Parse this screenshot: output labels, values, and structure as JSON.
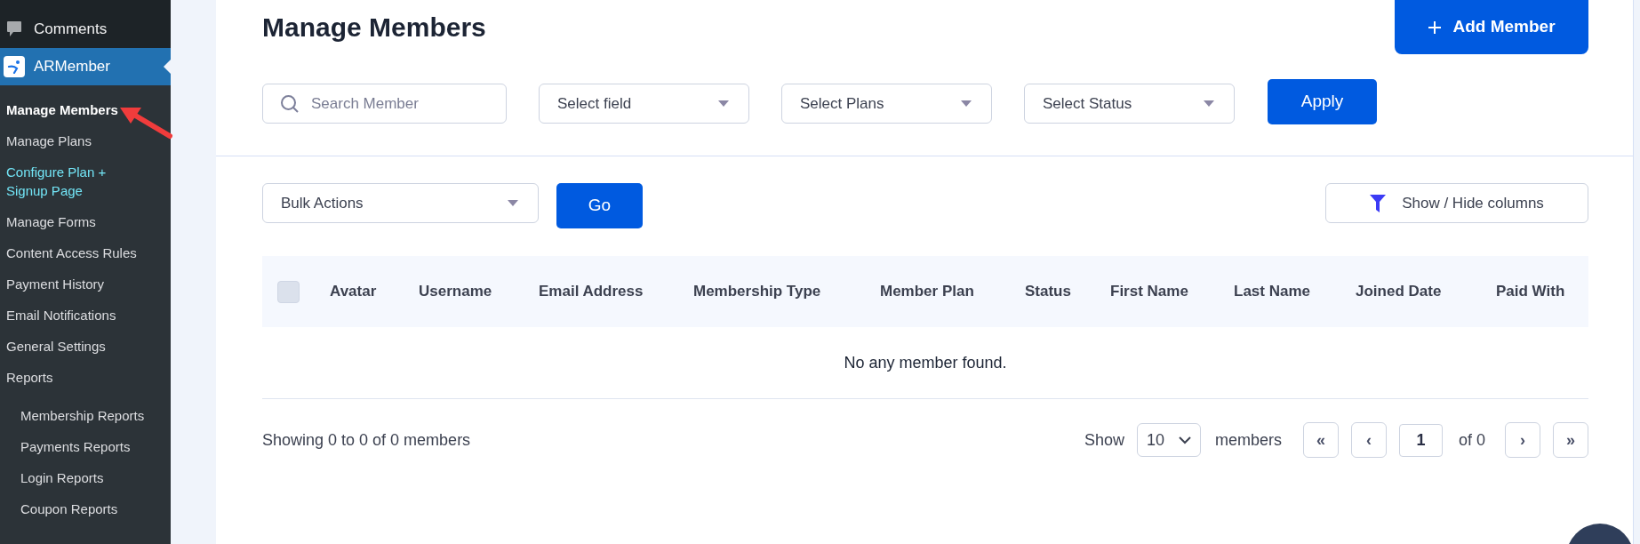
{
  "sidebar": {
    "items": [
      {
        "label": "Comments",
        "kind": "comments",
        "selected": false
      },
      {
        "label": "ARMember",
        "kind": "plugin",
        "selected": true
      }
    ],
    "submenu": [
      {
        "label": "Manage Members",
        "selected": true,
        "hovered": false
      },
      {
        "label": "Manage Plans",
        "selected": false,
        "hovered": false
      },
      {
        "label": "Configure Plan + Signup Page",
        "selected": false,
        "hovered": true
      },
      {
        "label": "Manage Forms",
        "selected": false,
        "hovered": false
      },
      {
        "label": "Content Access Rules",
        "selected": false,
        "hovered": false
      },
      {
        "label": "Payment History",
        "selected": false,
        "hovered": false
      },
      {
        "label": "Email Notifications",
        "selected": false,
        "hovered": false
      },
      {
        "label": "General Settings",
        "selected": false,
        "hovered": false
      },
      {
        "label": "Reports",
        "selected": false,
        "hovered": false,
        "children": [
          {
            "label": "Membership Reports",
            "selected": false,
            "hovered": false
          },
          {
            "label": "Payments Reports",
            "selected": false,
            "hovered": false
          },
          {
            "label": "Login Reports",
            "selected": false,
            "hovered": false
          },
          {
            "label": "Coupon Reports",
            "selected": false,
            "hovered": false
          }
        ]
      }
    ]
  },
  "page": {
    "title": "Manage Members",
    "add_button": "Add Member"
  },
  "filters": {
    "search": {
      "placeholder": "Search Member"
    },
    "selects": [
      "Select field",
      "Select Plans",
      "Select Status"
    ],
    "apply_button": "Apply"
  },
  "bulk": {
    "select": "Bulk Actions",
    "go_button": "Go",
    "columns_button": "Show / Hide columns"
  },
  "table": {
    "select_all_checked": false,
    "columns": [
      "Avatar",
      "Username",
      "Email Address",
      "Membership Type",
      "Member Plan",
      "Status",
      "First Name",
      "Last Name",
      "Joined Date",
      "Paid With"
    ],
    "empty_message": "No any member found."
  },
  "footer": {
    "summary": "Showing 0 to 0 of 0 members",
    "show_label": "Show",
    "per_page": "10",
    "members_label": "members",
    "first": "«",
    "prev": "‹",
    "page": "1",
    "of_label": "of 0",
    "next": "›",
    "last": "»"
  }
}
